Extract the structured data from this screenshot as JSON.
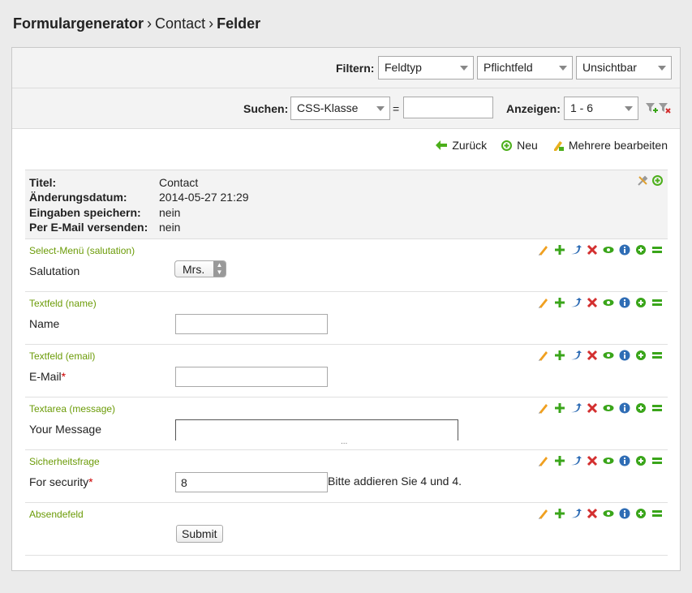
{
  "breadcrumb": {
    "root": "Formulargenerator",
    "sep1": "›",
    "middle": "Contact",
    "sep2": "›",
    "current": "Felder"
  },
  "filter": {
    "label": "Filtern:",
    "feldtyp": "Feldtyp",
    "pflichtfeld": "Pflichtfeld",
    "unsichtbar": "Unsichtbar"
  },
  "search": {
    "label": "Suchen:",
    "column": "CSS-Klasse",
    "operator": "=",
    "value": "",
    "show_label": "Anzeigen:",
    "range": "1 - 6"
  },
  "actions": {
    "back": "Zurück",
    "new": "Neu",
    "bulk_edit": "Mehrere bearbeiten"
  },
  "form_info": {
    "title_label": "Titel:",
    "title_value": "Contact",
    "date_label": "Änderungsdatum:",
    "date_value": "2014-05-27 21:29",
    "store_label": "Eingaben speichern:",
    "store_value": "nein",
    "email_label": "Per E-Mail versenden:",
    "email_value": "nein"
  },
  "fields": [
    {
      "title": "Select-Menü (salutation)",
      "label": "Salutation",
      "required": false,
      "control": "select",
      "value": "Mrs."
    },
    {
      "title": "Textfeld (name)",
      "label": "Name",
      "required": false,
      "control": "text",
      "value": ""
    },
    {
      "title": "Textfeld (email)",
      "label": "E-Mail",
      "required": true,
      "control": "text",
      "value": ""
    },
    {
      "title": "Textarea (message)",
      "label": "Your Message",
      "required": false,
      "control": "textarea",
      "value": "",
      "resize": "..."
    },
    {
      "title": "Sicherheitsfrage",
      "label": "For security",
      "required": true,
      "control": "text",
      "value": "8",
      "hint": "Bitte addieren Sie 4 und 4."
    },
    {
      "title": "Absendefeld",
      "label": "",
      "required": false,
      "control": "button",
      "value": "Submit"
    }
  ],
  "required_marker": "*",
  "colors": {
    "field_title": "#6b9b07",
    "required": "#cc0000",
    "green_icon": "#4caf1a",
    "delete_icon": "#d32f2f",
    "info_icon": "#2f6db5",
    "edit_icon": "#f0a020"
  }
}
